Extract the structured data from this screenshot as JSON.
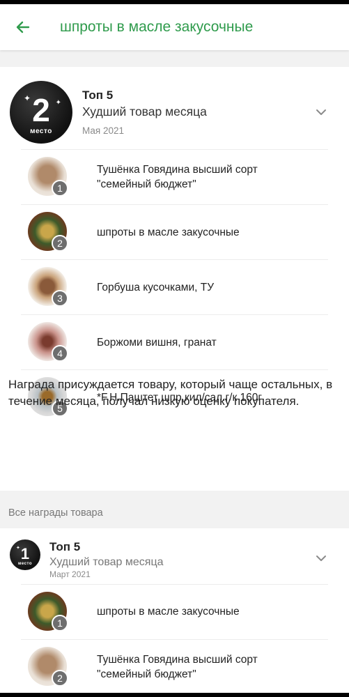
{
  "header": {
    "title": "шпроты в масле закусочные"
  },
  "award_main": {
    "medal_number": "2",
    "medal_place": "место",
    "top": "Топ 5",
    "name": "Худший товар месяца",
    "date": "Мая 2021",
    "items": [
      {
        "rank": "1",
        "title": "Тушёнка Говядина высший сорт \"семейный бюджет\""
      },
      {
        "rank": "2",
        "title": "шпроты в масле закусочные"
      },
      {
        "rank": "3",
        "title": "Горбуша кусочками, ТУ"
      },
      {
        "rank": "4",
        "title": "Боржоми вишня, гранат"
      },
      {
        "rank": "5",
        "title": "*F.H.Паштет шпр.кил/сал.г/к 160г"
      }
    ],
    "note": "Награда присуждается товару, который чаще остальных, в течение месяца, получал низкую оценку покупателя."
  },
  "section_label": "Все награды товара",
  "award_second": {
    "medal_number": "1",
    "medal_place": "место",
    "top": "Топ 5",
    "name": "Худший товар месяца",
    "date": "Март 2021",
    "items": [
      {
        "rank": "1",
        "title": "шпроты в масле закусочные"
      },
      {
        "rank": "2",
        "title": "Тушёнка Говядина высший сорт \"семейный бюджет\""
      }
    ]
  }
}
